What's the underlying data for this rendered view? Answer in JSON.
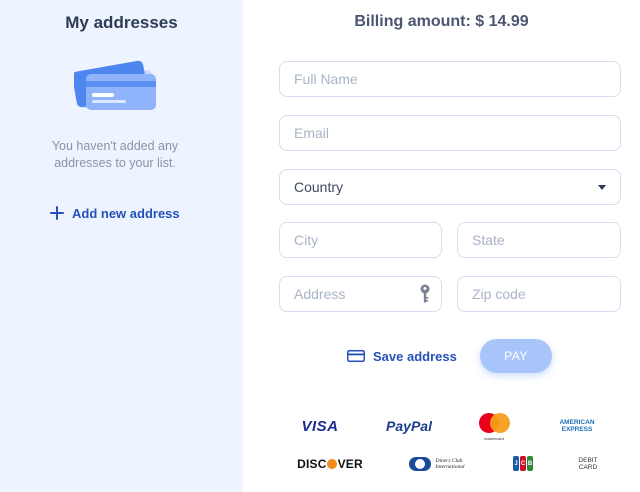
{
  "left": {
    "title": "My addresses",
    "empty_text": "You haven't added any addresses to your list.",
    "add_label": "Add new address"
  },
  "billing": {
    "label": "Billing amount: $ 14.99"
  },
  "form": {
    "full_name_placeholder": "Full Name",
    "email_placeholder": "Email",
    "country_value": "Country",
    "city_placeholder": "City",
    "state_placeholder": "State",
    "address_placeholder": "Address",
    "zip_placeholder": "Zip code"
  },
  "actions": {
    "save_label": "Save address",
    "pay_label": "PAY"
  },
  "payment_logos": {
    "visa": "VISA",
    "paypal": "PayPal",
    "mastercard": "mastercard",
    "amex_line1": "AMERICAN",
    "amex_line2": "EXPRESS",
    "discover_pre": "DISC",
    "discover_post": "VER",
    "diners_line1": "Diners Club",
    "diners_line2": "International",
    "jcb_j": "J",
    "jcb_c": "C",
    "jcb_b": "B",
    "debit_line1": "DEBIT",
    "debit_line2": "CARD"
  },
  "icons": {
    "add": "plus-icon",
    "save": "credit-card-icon",
    "address_field": "key-icon",
    "country_select": "caret-down-icon"
  },
  "colors": {
    "accent": "#2452b9",
    "left_panel_bg": "#eef4ff",
    "pay_button_bg": "#a7c5fb",
    "field_border": "#d5dff0"
  }
}
